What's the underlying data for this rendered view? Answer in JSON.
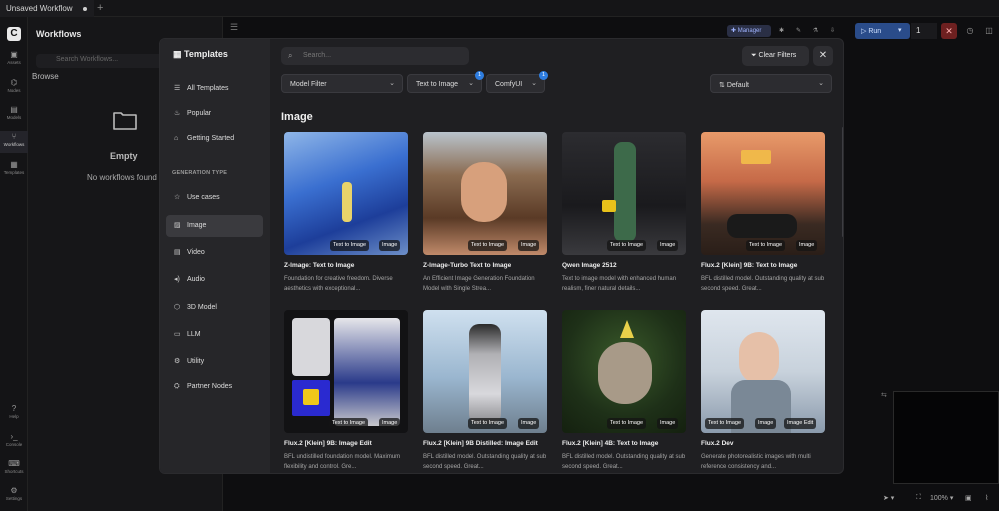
{
  "tab": {
    "title": "Unsaved Workflow",
    "plus": "+"
  },
  "rail": {
    "items": [
      {
        "label": "Assets",
        "icon": "assets-icon"
      },
      {
        "label": "Nodes",
        "icon": "nodes-icon"
      },
      {
        "label": "Models",
        "icon": "models-icon"
      },
      {
        "label": "Workflows",
        "icon": "workflows-icon"
      },
      {
        "label": "Templates",
        "icon": "templates-icon"
      }
    ],
    "bottom": [
      {
        "label": "Help"
      },
      {
        "label": "Console"
      },
      {
        "label": "Shortcuts"
      },
      {
        "label": "Settings"
      }
    ]
  },
  "workflows": {
    "title": "Workflows",
    "search_placeholder": "Search Workflows...",
    "browse": "Browse",
    "empty_title": "Empty",
    "empty_text": "No workflows found"
  },
  "toolbar": {
    "manager": "Manager",
    "run": "Run",
    "count": "1",
    "zoom": "100%"
  },
  "modal": {
    "title": "Templates",
    "search_placeholder": "Search...",
    "clear_filters": "Clear Filters",
    "nav": [
      {
        "label": "All Templates",
        "icon": "list-icon"
      },
      {
        "label": "Popular",
        "icon": "fire-icon"
      },
      {
        "label": "Getting Started",
        "icon": "graduation-icon"
      }
    ],
    "section_label": "GENERATION TYPE",
    "nav2": [
      {
        "label": "Use cases",
        "icon": "star-icon"
      },
      {
        "label": "Image",
        "icon": "image-icon"
      },
      {
        "label": "Video",
        "icon": "video-icon"
      },
      {
        "label": "Audio",
        "icon": "audio-icon"
      },
      {
        "label": "3D Model",
        "icon": "cube-icon"
      },
      {
        "label": "LLM",
        "icon": "chat-icon"
      },
      {
        "label": "Utility",
        "icon": "gear-icon"
      },
      {
        "label": "Partner Nodes",
        "icon": "handshake-icon"
      }
    ],
    "filters": {
      "model": "Model Filter",
      "task": "Text to Image",
      "task_badge": "1",
      "provider": "ComfyUI",
      "provider_badge": "1",
      "sort": "Default"
    },
    "section_title": "Image",
    "cards": [
      {
        "title": "Z-Image: Text to Image",
        "desc": "Foundation for creative freedom. Diverse aesthetics with exceptional...",
        "tags": [
          "Text to Image",
          "Image"
        ]
      },
      {
        "title": "Z-Image-Turbo Text to Image",
        "desc": "An Efficient Image Generation Foundation Model with Single Strea...",
        "tags": [
          "Text to Image",
          "Image"
        ]
      },
      {
        "title": "Qwen Image 2512",
        "desc": "Text to image model with enhanced human realism, finer natural details...",
        "tags": [
          "Text to Image",
          "Image"
        ]
      },
      {
        "title": "Flux.2 [Klein] 9B: Text to Image",
        "desc": "BFL distilled model. Outstanding quality at sub second speed. Great...",
        "tags": [
          "Text to Image",
          "Image"
        ]
      },
      {
        "title": "Flux.2 [Klein] 9B: Image Edit",
        "desc": "BFL undistilled foundation model. Maximum flexibility and control. Gre...",
        "tags": [
          "Text to Image",
          "Image"
        ]
      },
      {
        "title": "Flux.2 [Klein] 9B Distilled: Image Edit",
        "desc": "BFL distilled model. Outstanding quality at sub second speed. Great...",
        "tags": [
          "Text to Image",
          "Image"
        ]
      },
      {
        "title": "Flux.2 [Klein] 4B: Text to Image",
        "desc": "BFL distilled model. Outstanding quality at sub second speed. Great...",
        "tags": [
          "Text to Image",
          "Image"
        ]
      },
      {
        "title": "Flux.2 Dev",
        "desc": "Generate photorealistic images with multi reference consistency and...",
        "tags": [
          "Text to Image",
          "Image",
          "Image Edit"
        ]
      }
    ]
  }
}
